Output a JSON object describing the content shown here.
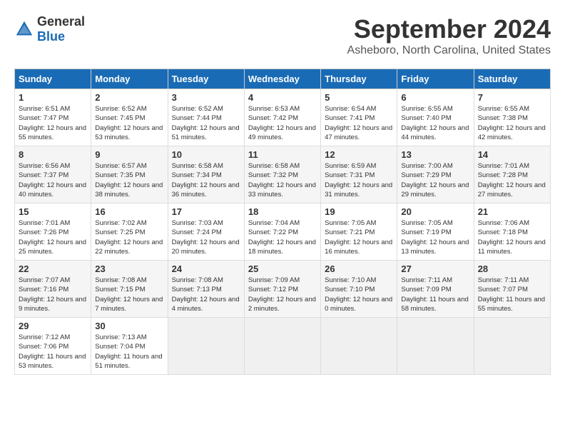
{
  "header": {
    "logo": {
      "general": "General",
      "blue": "Blue"
    },
    "title": "September 2024",
    "location": "Asheboro, North Carolina, United States"
  },
  "calendar": {
    "days_of_week": [
      "Sunday",
      "Monday",
      "Tuesday",
      "Wednesday",
      "Thursday",
      "Friday",
      "Saturday"
    ],
    "weeks": [
      [
        {
          "day": "",
          "empty": true
        },
        {
          "day": "2",
          "sunrise": "6:52 AM",
          "sunset": "7:45 PM",
          "daylight": "12 hours and 53 minutes."
        },
        {
          "day": "3",
          "sunrise": "6:52 AM",
          "sunset": "7:44 PM",
          "daylight": "12 hours and 51 minutes."
        },
        {
          "day": "4",
          "sunrise": "6:53 AM",
          "sunset": "7:42 PM",
          "daylight": "12 hours and 49 minutes."
        },
        {
          "day": "5",
          "sunrise": "6:54 AM",
          "sunset": "7:41 PM",
          "daylight": "12 hours and 47 minutes."
        },
        {
          "day": "6",
          "sunrise": "6:55 AM",
          "sunset": "7:40 PM",
          "daylight": "12 hours and 44 minutes."
        },
        {
          "day": "7",
          "sunrise": "6:55 AM",
          "sunset": "7:38 PM",
          "daylight": "12 hours and 42 minutes."
        }
      ],
      [
        {
          "day": "1",
          "sunrise": "6:51 AM",
          "sunset": "7:47 PM",
          "daylight": "12 hours and 55 minutes."
        },
        {
          "day": "",
          "empty": true
        },
        {
          "day": "",
          "empty": true
        },
        {
          "day": "",
          "empty": true
        },
        {
          "day": "",
          "empty": true
        },
        {
          "day": "",
          "empty": true
        },
        {
          "day": "",
          "empty": true
        }
      ],
      [
        {
          "day": "8",
          "sunrise": "6:56 AM",
          "sunset": "7:37 PM",
          "daylight": "12 hours and 40 minutes."
        },
        {
          "day": "9",
          "sunrise": "6:57 AM",
          "sunset": "7:35 PM",
          "daylight": "12 hours and 38 minutes."
        },
        {
          "day": "10",
          "sunrise": "6:58 AM",
          "sunset": "7:34 PM",
          "daylight": "12 hours and 36 minutes."
        },
        {
          "day": "11",
          "sunrise": "6:58 AM",
          "sunset": "7:32 PM",
          "daylight": "12 hours and 33 minutes."
        },
        {
          "day": "12",
          "sunrise": "6:59 AM",
          "sunset": "7:31 PM",
          "daylight": "12 hours and 31 minutes."
        },
        {
          "day": "13",
          "sunrise": "7:00 AM",
          "sunset": "7:29 PM",
          "daylight": "12 hours and 29 minutes."
        },
        {
          "day": "14",
          "sunrise": "7:01 AM",
          "sunset": "7:28 PM",
          "daylight": "12 hours and 27 minutes."
        }
      ],
      [
        {
          "day": "15",
          "sunrise": "7:01 AM",
          "sunset": "7:26 PM",
          "daylight": "12 hours and 25 minutes."
        },
        {
          "day": "16",
          "sunrise": "7:02 AM",
          "sunset": "7:25 PM",
          "daylight": "12 hours and 22 minutes."
        },
        {
          "day": "17",
          "sunrise": "7:03 AM",
          "sunset": "7:24 PM",
          "daylight": "12 hours and 20 minutes."
        },
        {
          "day": "18",
          "sunrise": "7:04 AM",
          "sunset": "7:22 PM",
          "daylight": "12 hours and 18 minutes."
        },
        {
          "day": "19",
          "sunrise": "7:05 AM",
          "sunset": "7:21 PM",
          "daylight": "12 hours and 16 minutes."
        },
        {
          "day": "20",
          "sunrise": "7:05 AM",
          "sunset": "7:19 PM",
          "daylight": "12 hours and 13 minutes."
        },
        {
          "day": "21",
          "sunrise": "7:06 AM",
          "sunset": "7:18 PM",
          "daylight": "12 hours and 11 minutes."
        }
      ],
      [
        {
          "day": "22",
          "sunrise": "7:07 AM",
          "sunset": "7:16 PM",
          "daylight": "12 hours and 9 minutes."
        },
        {
          "day": "23",
          "sunrise": "7:08 AM",
          "sunset": "7:15 PM",
          "daylight": "12 hours and 7 minutes."
        },
        {
          "day": "24",
          "sunrise": "7:08 AM",
          "sunset": "7:13 PM",
          "daylight": "12 hours and 4 minutes."
        },
        {
          "day": "25",
          "sunrise": "7:09 AM",
          "sunset": "7:12 PM",
          "daylight": "12 hours and 2 minutes."
        },
        {
          "day": "26",
          "sunrise": "7:10 AM",
          "sunset": "7:10 PM",
          "daylight": "12 hours and 0 minutes."
        },
        {
          "day": "27",
          "sunrise": "7:11 AM",
          "sunset": "7:09 PM",
          "daylight": "11 hours and 58 minutes."
        },
        {
          "day": "28",
          "sunrise": "7:11 AM",
          "sunset": "7:07 PM",
          "daylight": "11 hours and 55 minutes."
        }
      ],
      [
        {
          "day": "29",
          "sunrise": "7:12 AM",
          "sunset": "7:06 PM",
          "daylight": "11 hours and 53 minutes."
        },
        {
          "day": "30",
          "sunrise": "7:13 AM",
          "sunset": "7:04 PM",
          "daylight": "11 hours and 51 minutes."
        },
        {
          "day": "",
          "empty": true
        },
        {
          "day": "",
          "empty": true
        },
        {
          "day": "",
          "empty": true
        },
        {
          "day": "",
          "empty": true
        },
        {
          "day": "",
          "empty": true
        }
      ]
    ]
  }
}
